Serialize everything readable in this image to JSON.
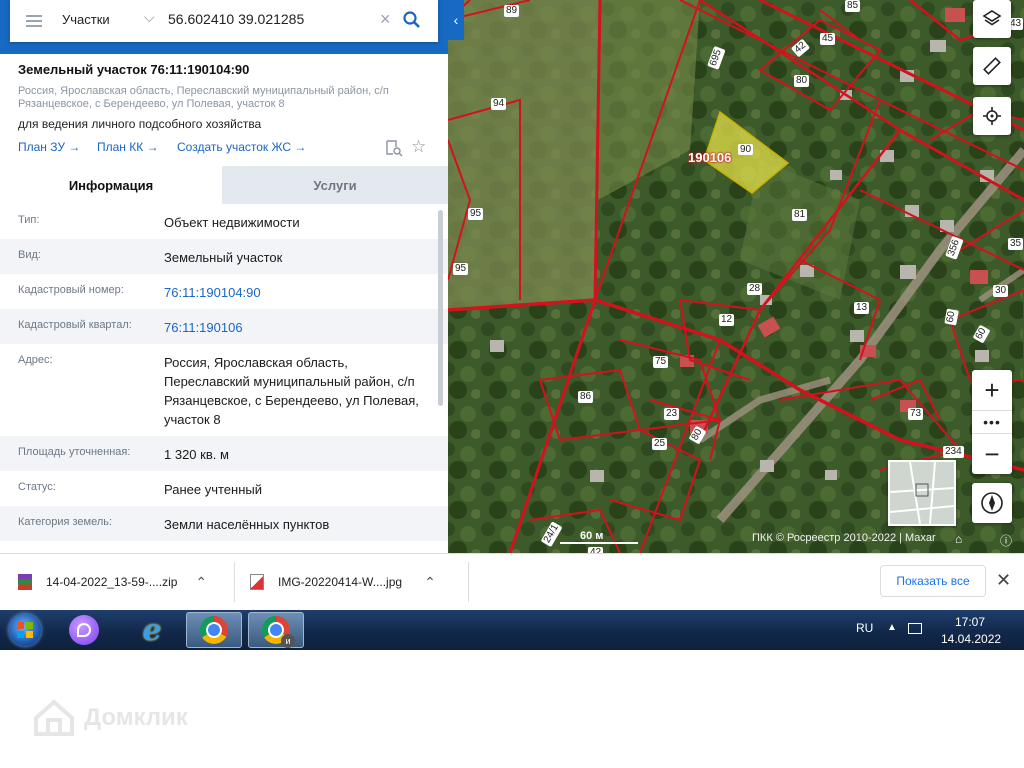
{
  "search": {
    "category": "Участки",
    "query": "56.602410 39.021285"
  },
  "plot": {
    "title": "Земельный участок 76:11:190104:90",
    "address_short": "Россия, Ярославская область, Переславский муниципальный район, с/п Рязанцевское, с Берендеево, ул Полевая, участок 8",
    "use": "для ведения личного подсобного хозяйства",
    "links": [
      "План ЗУ →",
      "План КК →",
      "Создать участок ЖС →"
    ]
  },
  "tabs": {
    "info": "Информация",
    "services": "Услуги"
  },
  "details": [
    {
      "key": "Тип:",
      "value": "Объект недвижимости"
    },
    {
      "key": "Вид:",
      "value": "Земельный участок"
    },
    {
      "key": "Кадастровый номер:",
      "value": "76:11:190104:90"
    },
    {
      "key": "Кадастровый квартал:",
      "value": "76:11:190106"
    },
    {
      "key": "Адрес:",
      "value": "Россия, Ярославская область, Переславский муниципальный район, с/п Рязанцевское, с Берендеево, ул Полевая, участок 8"
    },
    {
      "key": "Площадь уточненная:",
      "value": "1 320 кв. м"
    },
    {
      "key": "Статус:",
      "value": "Ранее учтенный"
    },
    {
      "key": "Категория земель:",
      "value": "Земли населённых пунктов"
    }
  ],
  "map": {
    "quarter_label": "190106",
    "selected_plot": "90",
    "parcel_numbers": [
      "89",
      "85",
      "42",
      "45",
      "80",
      "695",
      "94",
      "81",
      "95",
      "95",
      "356",
      "35",
      "30",
      "28",
      "12",
      "13",
      "60",
      "60",
      "75",
      "86",
      "23",
      "80",
      "73",
      "25",
      "234",
      "24/1",
      "42",
      "43"
    ],
    "scale": "60 м",
    "attribution": "ПКК © Росреестр 2010-2022 | Maxar",
    "colors": {
      "boundary": "#d4121d",
      "selected": "#e3e04a"
    }
  },
  "downloads": {
    "items": [
      "14-04-2022_13-59-....zip",
      "IMG-20220414-W....jpg"
    ],
    "show_all": "Показать все"
  },
  "taskbar": {
    "lang": "RU",
    "time": "17:07",
    "date": "14.04.2022"
  },
  "watermark": "Домклик"
}
